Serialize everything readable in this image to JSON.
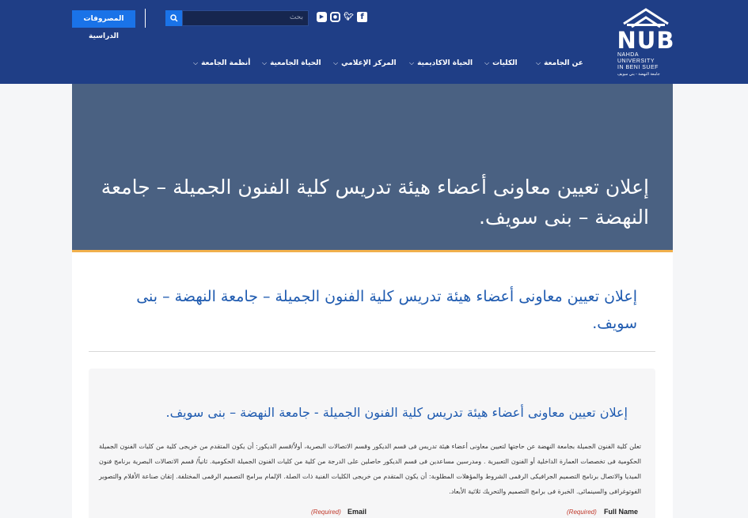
{
  "header": {
    "logo_text": "NUB",
    "logo_sub_line1": "NAHDA UNIVERSITY",
    "logo_sub_line2": "IN BENI SUEF",
    "logo_sub_line3": "جامعة النهضة - بني سويف",
    "search_placeholder": "بحث",
    "fees_button": "المصروفات الدراسية",
    "social": [
      "facebook-icon",
      "twitter-icon",
      "instagram-icon",
      "youtube-icon"
    ]
  },
  "nav": {
    "items": [
      {
        "label": "عن الجامعة"
      },
      {
        "label": "الكليات"
      },
      {
        "label": "الحياة الاكاديمية"
      },
      {
        "label": "المركز الإعلامي"
      },
      {
        "label": "الحياة الجامعية"
      },
      {
        "label": "أنظمة الجامعة"
      }
    ]
  },
  "hero": {
    "title": "إعلان تعيين معاونى أعضاء هيئة تدريس كلية الفنون الجميلة – جامعة النهضة – بنى سويف."
  },
  "card": {
    "title": "إعلان تعيين معاونى أعضاء هيئة تدريس كلية الفنون الجميلة – جامعة النهضة – بنى سويف."
  },
  "article": {
    "title": "إعلان تعيين معاونى أعضاء هيئة تدريس كلية الفنون الجميلة - جامعة النهضة – بنى سويف.",
    "body": "تعلن كلية الفنون الجميلة بجامعة النهضة عن حاجتها لتعيين معاونى أعضاء هيئة تدريس فى قسم الديكور وقسم الاتصالات البصرية، أولاً/قسم الديكور: أن يكون المتقدم من خريجى كلية من كليات الفنون الجميلة الحكومية فى تخصصات العمارة الداخلية أو الفنون التعبيرية . ومدرسين مساعدين فى قسم الديكور حاصلين على الدرجة من كلية من كليات الفنون الجميلة الحكومية. ثانياً/ قسم الاتصالات البصرية برنامج فنون الميديا والاتصال برنامج التصميم الجرافيكى الرقمى الشروط والمؤهلات المطلوبة: أن يكون المتقدم من خريجى الكليات الفنية ذات الصلة. الإلمام ببرامج التصميم الرقمى المختلفة. إتقان صناعة الأفلام والتصوير الفوتوغرافى والسينمائى. الخبرة فى برامج التصميم والتحريك ثلاثية الأبعاد."
  },
  "form": {
    "full_name_label": "Full Name",
    "email_label": "Email",
    "required_text": "(Required)"
  }
}
